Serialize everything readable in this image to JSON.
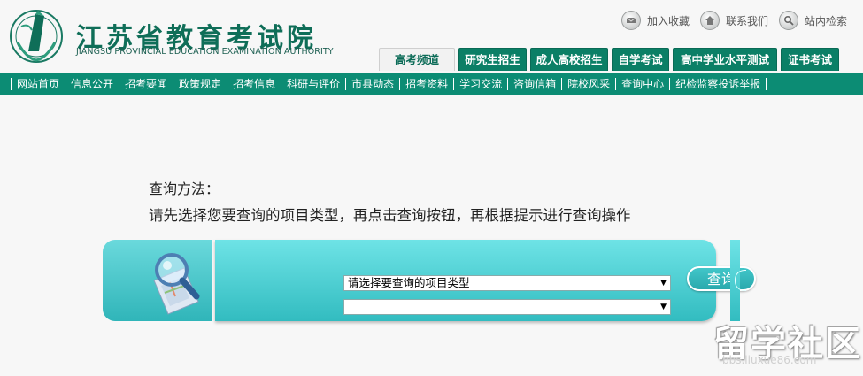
{
  "header": {
    "title": "江苏省教育考试院",
    "subtitle": "JIANGSU PROVINCIAL EDUCATION EXAMINATION AUTHORITY",
    "logo_icon": "jiangsu-education-exam-logo",
    "top_links": [
      {
        "label": "加入收藏",
        "icon": "bookmark-icon"
      },
      {
        "label": "联系我们",
        "icon": "home-icon"
      },
      {
        "label": "站内检索",
        "icon": "search-icon"
      }
    ],
    "tabs": [
      {
        "label": "高考频道",
        "active": true
      },
      {
        "label": "研究生招生",
        "active": false
      },
      {
        "label": "成人高校招生",
        "active": false
      },
      {
        "label": "自学考试",
        "active": false
      },
      {
        "label": "高中学业水平测试",
        "active": false
      },
      {
        "label": "证书考试",
        "active": false
      }
    ]
  },
  "nav": {
    "items": [
      "网站首页",
      "信息公开",
      "招考要闻",
      "政策规定",
      "招考信息",
      "科研与评价",
      "市县动态",
      "招考资料",
      "学习交流",
      "咨询信箱",
      "院校风采",
      "查询中心",
      "纪检监察投诉举报"
    ]
  },
  "main": {
    "method_title": "查询方法：",
    "method_desc": "请先选择您要查询的项目类型，再点击查询按钮，再根据提示进行查询操作",
    "query_panel": {
      "select1_value": "请选择要查询的项目类型",
      "select2_value": "",
      "query_button": "查询"
    }
  },
  "watermark": {
    "text": "留学社区",
    "url": "bbs.liuxue86.com"
  },
  "colors": {
    "brand_green": "#0c8c74",
    "panel_cyan": "#4cd0d3",
    "title_green": "#0f6e58"
  }
}
